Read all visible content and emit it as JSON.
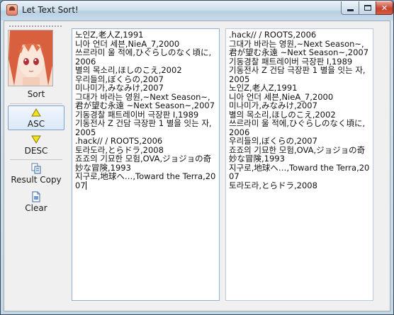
{
  "window": {
    "title": "Let Text Sort!",
    "close_glyph": "✕"
  },
  "toolbar": {
    "sort_label": "Sort",
    "asc_label": "ASC",
    "desc_label": "DESC",
    "copy_label": "Result Copy",
    "clear_label": "Clear",
    "selected_order": "ASC"
  },
  "icons": {
    "app": "app-icon",
    "avatar": "anime-girl-avatar",
    "asc": "up-triangle-icon",
    "desc": "down-triangle-icon",
    "copy": "copy-icon",
    "clear": "clear-icon"
  },
  "colors": {
    "arrow_fill": "#f2e21a",
    "arrow_stroke": "#8a7a10",
    "selected_border": "#7da2ce",
    "close_red": "#c8432e"
  },
  "input_text": "노인Z,老人Z,1991\n니아 언더 세븐,NieA_7,2000\n쓰르라미 울 적에,ひぐらしのなく頃に,2006\n별의 목소리,ほしのこえ,2002\n우리들의,ぼくらの,2007\n미나미가,みなみけ,2007\n그대가 바라는 영원,~Next Season~,君が望む永遠 ~Next Season~,2007\n기동경찰 패트레이버 극장판 I,1989\n기동전사 Z 건담 극장판 1 별을 잇는 자,2005\n.hack// / ROOTS,2006\n토라도라,とらドラ,2008\n죠죠의 기묘한 모험,OVA,ジョジョの奇妙な冒険,1993\n지구로,地球へ…,Toward the Terra,2007",
  "output_text": ".hack// / ROOTS,2006\n그대가 바라는 영원,~Next Season~,君が望む永遠 ~Next Season~,2007\n기동경찰 패트레이버 극장판 I,1989\n기동전사 Z 건담 극장판 1 별을 잇는 자,2005\n노인Z,老人Z,1991\n니아 언더 세븐,NieA_7,2000\n미나미가,みなみけ,2007\n별의 목소리,ほしのこえ,2002\n쓰르라미 울 적에,ひぐらしのなく頃に,2006\n우리들의,ぼくらの,2007\n죠죠의 기묘한 모험,OVA,ジョジョの奇妙な冒険,1993\n지구로,地球へ…,Toward the Terra,2007\n토라도라,とらドラ,2008"
}
